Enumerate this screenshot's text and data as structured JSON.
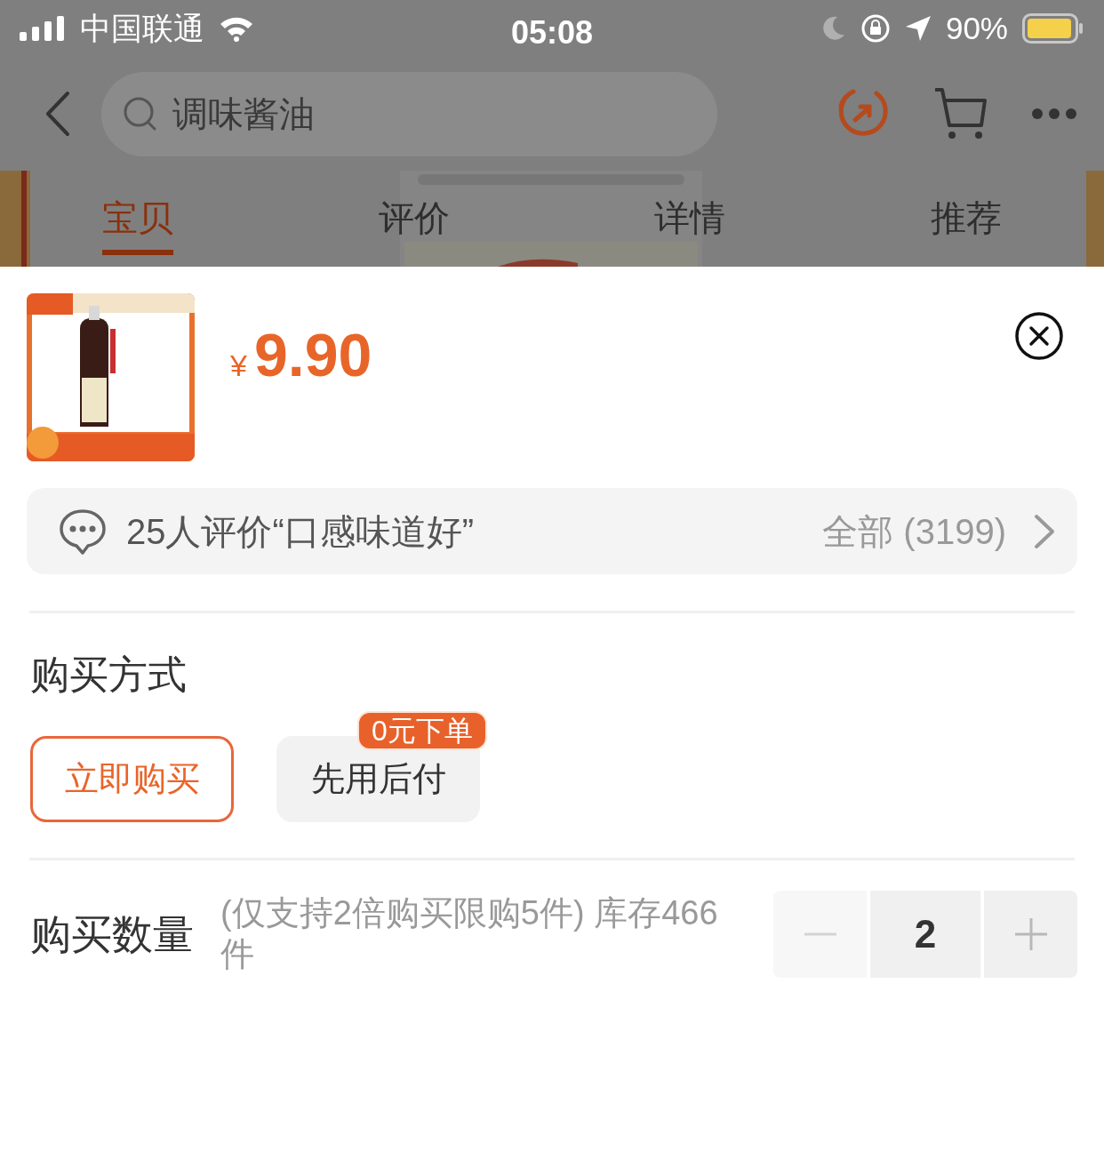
{
  "status_bar": {
    "carrier": "中国联通",
    "time": "05:08",
    "battery": "90%"
  },
  "search": {
    "placeholder": "调味酱油"
  },
  "tabs": [
    {
      "label": "宝贝",
      "selected": true
    },
    {
      "label": "评价",
      "selected": false
    },
    {
      "label": "详情",
      "selected": false
    },
    {
      "label": "推荐",
      "selected": false
    }
  ],
  "product": {
    "currency": "¥",
    "price": "9.90"
  },
  "review_summary": {
    "text": "25人评价“口感味道好”",
    "all_link": "全部 (3199)"
  },
  "purchase_method": {
    "title": "购买方式",
    "options": [
      {
        "label": "立即购买",
        "selected": true
      },
      {
        "label": "先用后付",
        "selected": false,
        "badge": "0元下单"
      }
    ]
  },
  "quantity": {
    "title": "购买数量",
    "note": "(仅支持2倍购买限购5件) 库存466件",
    "value": "2",
    "decrement_disabled": true,
    "increment_disabled": false
  }
}
